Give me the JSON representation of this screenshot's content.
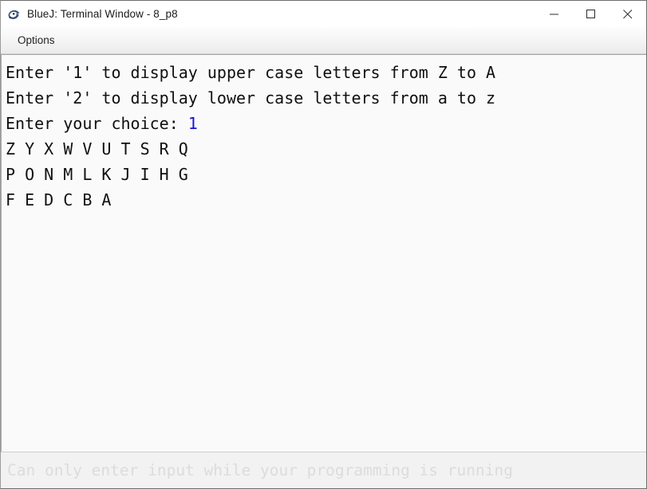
{
  "window": {
    "title": "BlueJ: Terminal Window - 8_p8",
    "icon": "bluej-bird-icon",
    "controls": [
      {
        "name": "minimize-button",
        "glyph": "minimize-icon"
      },
      {
        "name": "maximize-button",
        "glyph": "maximize-icon"
      },
      {
        "name": "close-button",
        "glyph": "close-icon"
      }
    ]
  },
  "menubar": {
    "items": [
      {
        "label": "Options"
      }
    ]
  },
  "terminal": {
    "lines": [
      {
        "text": "Enter '1' to display upper case letters from Z to A",
        "input": ""
      },
      {
        "text": "Enter '2' to display lower case letters from a to z",
        "input": ""
      },
      {
        "text": "Enter your choice: ",
        "input": "1"
      },
      {
        "text": "Z Y X W V U T S R Q",
        "input": ""
      },
      {
        "text": "P O N M L K J I H G",
        "input": ""
      },
      {
        "text": "F E D C B A",
        "input": ""
      }
    ],
    "input_color": "#1212e0",
    "background": "#fafafa",
    "text_color": "#101010"
  },
  "statusbar": {
    "message": "Can only enter input while your programming is running",
    "text_color": "#dcdcdc"
  }
}
